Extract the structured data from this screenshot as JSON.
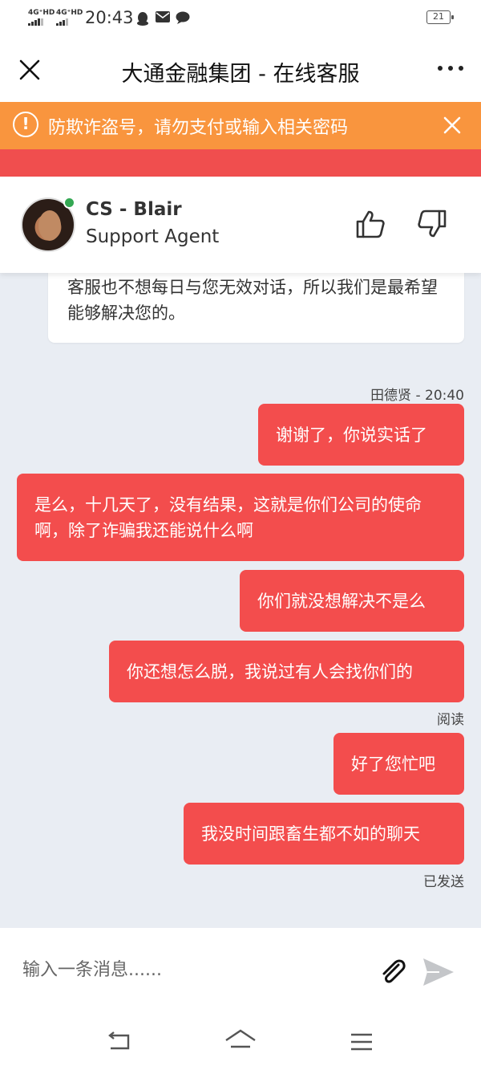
{
  "status_bar": {
    "network_1": "4G⁺HD",
    "network_2": "4G⁺HD",
    "time": "20:43",
    "battery": "21"
  },
  "header": {
    "title": "大通金融集团 - 在线客服"
  },
  "warning": {
    "text": "防欺诈盗号，请勿支付或输入相关密码",
    "icon": "!"
  },
  "agent": {
    "name": "CS - Blair",
    "role": "Support Agent"
  },
  "messages": {
    "agent_text": "客服也不想每日与您无效对话，所以我们是最希望能够解决您的。",
    "user_meta": "田德贤 - 20:40",
    "m1": "谢谢了，你说实话了",
    "m2": "是么，十几天了，没有结果，这就是你们公司的使命啊，除了诈骗我还能说什么啊",
    "m3": "你们就没想解决不是么",
    "m4": "你还想怎么脱，我说过有人会找你们的",
    "status_read": "阅读",
    "m5": "好了您忙吧",
    "m6": "我没时间跟畜生都不如的聊天",
    "status_sent": "已发送"
  },
  "input": {
    "placeholder": "输入一条消息......"
  },
  "colors": {
    "warning_bg": "#f9953e",
    "accent_red": "#f34d4d",
    "chat_bg": "#e9edf3",
    "online": "#34a853"
  }
}
